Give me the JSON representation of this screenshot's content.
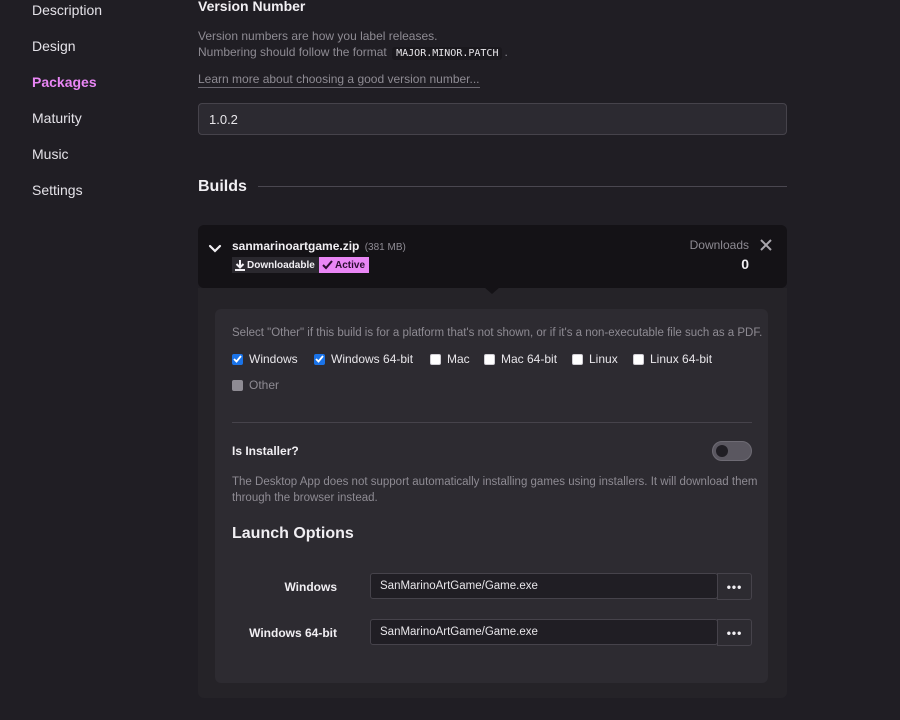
{
  "sidebar": {
    "items": [
      {
        "label": "Description",
        "active": false
      },
      {
        "label": "Design",
        "active": false
      },
      {
        "label": "Packages",
        "active": true
      },
      {
        "label": "Maturity",
        "active": false
      },
      {
        "label": "Music",
        "active": false
      },
      {
        "label": "Settings",
        "active": false
      }
    ]
  },
  "version": {
    "title": "Version Number",
    "desc_line1": "Version numbers are how you label releases.",
    "desc_line2_prefix": "Numbering should follow the format",
    "format_code": "MAJOR.MINOR.PATCH",
    "desc_line2_suffix": ".",
    "learn_more": "Learn more about choosing a good version number...",
    "value": "1.0.2"
  },
  "builds": {
    "title": "Builds",
    "build": {
      "filename": "sanmarinoartgame.zip",
      "size": "(381 MB)",
      "badge_downloadable": "Downloadable",
      "badge_active": "Active",
      "downloads_label": "Downloads",
      "downloads_count": "0",
      "platform_hint": "Select \"Other\" if this build is for a platform that's not shown, or if it's a non-executable file such as a PDF.",
      "platforms": [
        {
          "label": "Windows",
          "checked": true
        },
        {
          "label": "Windows 64-bit",
          "checked": true
        },
        {
          "label": "Mac",
          "checked": false
        },
        {
          "label": "Mac 64-bit",
          "checked": false
        },
        {
          "label": "Linux",
          "checked": false
        },
        {
          "label": "Linux 64-bit",
          "checked": false
        },
        {
          "label": "Other",
          "checked": false,
          "disabled": true
        }
      ],
      "installer_label": "Is Installer?",
      "installer_enabled": false,
      "installer_desc": "The Desktop App does not support automatically installing games using installers. It will download them through the browser instead.",
      "launch_title": "Launch Options",
      "launch_options": [
        {
          "platform": "Windows",
          "path": "SanMarinoArtGame/Game.exe",
          "more": "•••"
        },
        {
          "platform": "Windows 64-bit",
          "path": "SanMarinoArtGame/Game.exe",
          "more": "•••"
        }
      ]
    }
  },
  "colors": {
    "accent": "#e986f5",
    "background": "#201e24",
    "checkbox": "#1a73e8"
  }
}
